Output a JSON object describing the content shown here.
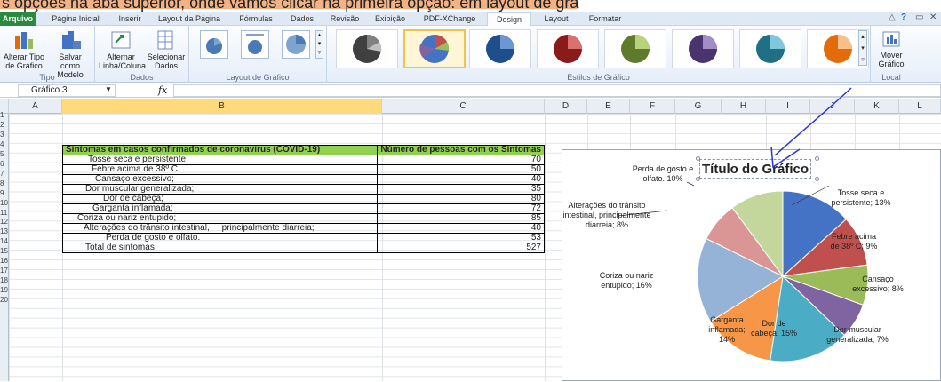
{
  "caption": "s opções na aba superior, onde vamos clicar na primeira opção: em layout de grá",
  "tabs": [
    "Arquivo",
    "Página Inicial",
    "Inserir",
    "Layout da Página",
    "Fórmulas",
    "Dados",
    "Revisão",
    "Exibição",
    "PDF-XChange",
    "Design",
    "Layout",
    "Formatar"
  ],
  "ribbon": {
    "tipo": {
      "b1": "Alterar Tipo de Gráfico",
      "b2": "Salvar como Modelo",
      "label": "Tipo"
    },
    "dados": {
      "b1": "Alternar Linha/Coluna",
      "b2": "Selecionar Dados",
      "label": "Dados"
    },
    "layout_label": "Layout de Gráfico",
    "estilos_label": "Estilos de Gráfico",
    "local": {
      "b1": "Mover Gráfico",
      "label": "Local"
    }
  },
  "namebox": "Gráfico 3",
  "fx": "fx",
  "columns": [
    "A",
    "B",
    "C",
    "D",
    "E",
    "F",
    "G",
    "H",
    "I",
    "J",
    "K",
    "L"
  ],
  "rows": [
    "1",
    "2",
    "3",
    "4",
    "5",
    "6",
    "7",
    "8",
    "9",
    "10",
    "11",
    "12",
    "13",
    "14",
    "15",
    "16",
    "17",
    "18",
    "19",
    "20"
  ],
  "table": {
    "header": [
      "Sintomas  em casos confirmados de coronavirus (COVID-19)",
      "Número de pessoas com os Sintomas"
    ],
    "rows": [
      {
        "label": "Tosse seca e persistente;",
        "value": "70"
      },
      {
        "label": "Febre acima de 38º C;",
        "value": "50"
      },
      {
        "label": "Cansaço excessivo;",
        "value": "40"
      },
      {
        "label": "Dor muscular generalizada;",
        "value": "35"
      },
      {
        "label": "Dor de cabeça;",
        "value": "80"
      },
      {
        "label": "Garganta inflamada;",
        "value": "72"
      },
      {
        "label": "Coriza ou nariz entupido;",
        "value": "85"
      },
      {
        "label": "Alterações do trânsito intestinal,     principalmente diarreia;",
        "value": "40"
      },
      {
        "label": "Perda de gosto e olfato.",
        "value": "53"
      },
      {
        "label": "Total de sintomas",
        "value": "527"
      }
    ]
  },
  "chart": {
    "title": "Título do Gráfico",
    "labels": [
      "Tosse seca e persistente; 13%",
      "Febre acima de 38º C; 9%",
      "Cansaço excessivo; 8%",
      "Dor muscular generalizada; 7%",
      "Dor de cabeça; 15%",
      "Garganta inflamada; 14%",
      "Coriza ou nariz entupido; 16%",
      "Alterações do trânsito intestinal, principalmente diarreia; 8%",
      "Perda de gosto e olfato. 10%"
    ],
    "slices": [
      {
        "value": 70,
        "color": "#4472c4"
      },
      {
        "value": 50,
        "color": "#c0504d"
      },
      {
        "value": 40,
        "color": "#9bbb59"
      },
      {
        "value": 35,
        "color": "#8064a2"
      },
      {
        "value": 80,
        "color": "#4bacc6"
      },
      {
        "value": 72,
        "color": "#f79646"
      },
      {
        "value": 85,
        "color": "#95b3d7"
      },
      {
        "value": 40,
        "color": "#d99694"
      },
      {
        "value": 53,
        "color": "#c3d69b"
      }
    ]
  }
}
